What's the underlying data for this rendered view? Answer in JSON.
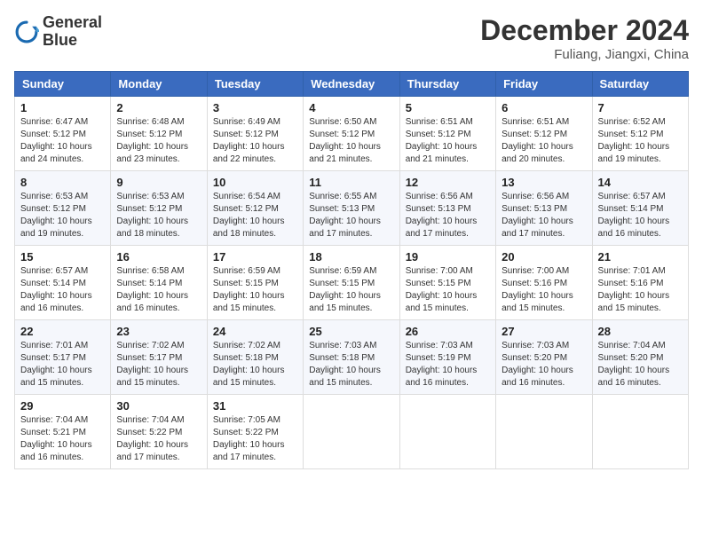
{
  "header": {
    "logo_line1": "General",
    "logo_line2": "Blue",
    "month_year": "December 2024",
    "location": "Fuliang, Jiangxi, China"
  },
  "weekdays": [
    "Sunday",
    "Monday",
    "Tuesday",
    "Wednesday",
    "Thursday",
    "Friday",
    "Saturday"
  ],
  "weeks": [
    [
      {
        "day": "1",
        "sunrise": "6:47 AM",
        "sunset": "5:12 PM",
        "daylight": "10 hours and 24 minutes."
      },
      {
        "day": "2",
        "sunrise": "6:48 AM",
        "sunset": "5:12 PM",
        "daylight": "10 hours and 23 minutes."
      },
      {
        "day": "3",
        "sunrise": "6:49 AM",
        "sunset": "5:12 PM",
        "daylight": "10 hours and 22 minutes."
      },
      {
        "day": "4",
        "sunrise": "6:50 AM",
        "sunset": "5:12 PM",
        "daylight": "10 hours and 21 minutes."
      },
      {
        "day": "5",
        "sunrise": "6:51 AM",
        "sunset": "5:12 PM",
        "daylight": "10 hours and 21 minutes."
      },
      {
        "day": "6",
        "sunrise": "6:51 AM",
        "sunset": "5:12 PM",
        "daylight": "10 hours and 20 minutes."
      },
      {
        "day": "7",
        "sunrise": "6:52 AM",
        "sunset": "5:12 PM",
        "daylight": "10 hours and 19 minutes."
      }
    ],
    [
      {
        "day": "8",
        "sunrise": "6:53 AM",
        "sunset": "5:12 PM",
        "daylight": "10 hours and 19 minutes."
      },
      {
        "day": "9",
        "sunrise": "6:53 AM",
        "sunset": "5:12 PM",
        "daylight": "10 hours and 18 minutes."
      },
      {
        "day": "10",
        "sunrise": "6:54 AM",
        "sunset": "5:12 PM",
        "daylight": "10 hours and 18 minutes."
      },
      {
        "day": "11",
        "sunrise": "6:55 AM",
        "sunset": "5:13 PM",
        "daylight": "10 hours and 17 minutes."
      },
      {
        "day": "12",
        "sunrise": "6:56 AM",
        "sunset": "5:13 PM",
        "daylight": "10 hours and 17 minutes."
      },
      {
        "day": "13",
        "sunrise": "6:56 AM",
        "sunset": "5:13 PM",
        "daylight": "10 hours and 17 minutes."
      },
      {
        "day": "14",
        "sunrise": "6:57 AM",
        "sunset": "5:14 PM",
        "daylight": "10 hours and 16 minutes."
      }
    ],
    [
      {
        "day": "15",
        "sunrise": "6:57 AM",
        "sunset": "5:14 PM",
        "daylight": "10 hours and 16 minutes."
      },
      {
        "day": "16",
        "sunrise": "6:58 AM",
        "sunset": "5:14 PM",
        "daylight": "10 hours and 16 minutes."
      },
      {
        "day": "17",
        "sunrise": "6:59 AM",
        "sunset": "5:15 PM",
        "daylight": "10 hours and 15 minutes."
      },
      {
        "day": "18",
        "sunrise": "6:59 AM",
        "sunset": "5:15 PM",
        "daylight": "10 hours and 15 minutes."
      },
      {
        "day": "19",
        "sunrise": "7:00 AM",
        "sunset": "5:15 PM",
        "daylight": "10 hours and 15 minutes."
      },
      {
        "day": "20",
        "sunrise": "7:00 AM",
        "sunset": "5:16 PM",
        "daylight": "10 hours and 15 minutes."
      },
      {
        "day": "21",
        "sunrise": "7:01 AM",
        "sunset": "5:16 PM",
        "daylight": "10 hours and 15 minutes."
      }
    ],
    [
      {
        "day": "22",
        "sunrise": "7:01 AM",
        "sunset": "5:17 PM",
        "daylight": "10 hours and 15 minutes."
      },
      {
        "day": "23",
        "sunrise": "7:02 AM",
        "sunset": "5:17 PM",
        "daylight": "10 hours and 15 minutes."
      },
      {
        "day": "24",
        "sunrise": "7:02 AM",
        "sunset": "5:18 PM",
        "daylight": "10 hours and 15 minutes."
      },
      {
        "day": "25",
        "sunrise": "7:03 AM",
        "sunset": "5:18 PM",
        "daylight": "10 hours and 15 minutes."
      },
      {
        "day": "26",
        "sunrise": "7:03 AM",
        "sunset": "5:19 PM",
        "daylight": "10 hours and 16 minutes."
      },
      {
        "day": "27",
        "sunrise": "7:03 AM",
        "sunset": "5:20 PM",
        "daylight": "10 hours and 16 minutes."
      },
      {
        "day": "28",
        "sunrise": "7:04 AM",
        "sunset": "5:20 PM",
        "daylight": "10 hours and 16 minutes."
      }
    ],
    [
      {
        "day": "29",
        "sunrise": "7:04 AM",
        "sunset": "5:21 PM",
        "daylight": "10 hours and 16 minutes."
      },
      {
        "day": "30",
        "sunrise": "7:04 AM",
        "sunset": "5:22 PM",
        "daylight": "10 hours and 17 minutes."
      },
      {
        "day": "31",
        "sunrise": "7:05 AM",
        "sunset": "5:22 PM",
        "daylight": "10 hours and 17 minutes."
      },
      null,
      null,
      null,
      null
    ]
  ]
}
